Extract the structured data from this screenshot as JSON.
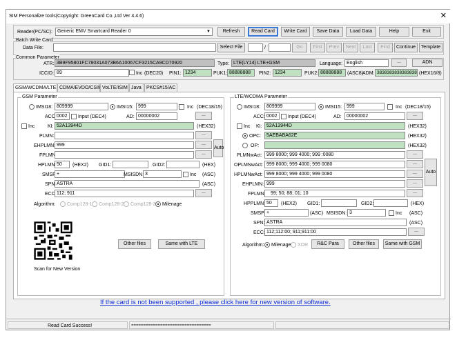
{
  "window": {
    "title": "SIM Personalize tools(Copyright: GreenCard Co.,Ltd Ver 4.4.6)",
    "close": "✕"
  },
  "toolbar": {
    "reader_label": "Reader(PC/SC):",
    "reader_value": "Generic EMV Smartcard Reader 0",
    "refresh": "Refresh",
    "read_card": "Read Card",
    "write_card": "Write Card",
    "save_data": "Save Data",
    "load_data": "Load Data",
    "help": "Help",
    "exit": "Exit"
  },
  "batch": {
    "title": "Batch Write Card",
    "data_file_label": "Data File:",
    "select_file": "Select File",
    "slash": "/",
    "go": "Go",
    "first": "First",
    "prev": "Prev",
    "next": "Next",
    "last": "Last",
    "find": "Find",
    "continue": "Continue",
    "template": "Template"
  },
  "common": {
    "title": "Common Parameter",
    "atr_label": "ATR:",
    "atr_value": "3B9F95801FC78031A073B6A10067CF3215CA9CD70920",
    "type_label": "Type:",
    "type_value": "LTE(LY14) LTE+GSM",
    "language_label": "Language:",
    "language_value": "English",
    "adn": "ADN",
    "iccid_label": "ICCID:",
    "iccid_value": "89",
    "inc": "Inc",
    "dec20": "(DEC20)",
    "pin1_label": "PIN1:",
    "pin1_value": "1234",
    "puk1_label": "PUK1:",
    "puk1_value": "88888888",
    "pin2_label": "PIN2:",
    "pin2_value": "1234",
    "puk2_label": "PUK2:",
    "puk2_value": "88888888",
    "asc8": "(ASC8)",
    "adm_label": "ADM:",
    "adm_value": "3838383838383838",
    "hex16_8": "(HEX16/8)"
  },
  "tabs": [
    "GSM/WCDMA/LTE",
    "CDMA/EVDO/CSIM",
    "VoLTE/ISIM",
    "Java",
    "PKCS#15/AC"
  ],
  "gsm": {
    "title": "GSM Parameter",
    "imsi18": "IMSI18:",
    "imsi18_value": "809999",
    "imsi15": "IMSI15:",
    "imsi15_value": "999",
    "inc": "Inc",
    "dec18_15": "(DEC18/15)",
    "acc_label": "ACC:",
    "acc_value": "0002",
    "input_dec4": "Input (DEC4)",
    "ad_label": "AD:",
    "ad_value": "00000002",
    "ki_inc": "Inc",
    "ki_label": "KI:",
    "ki_value": "52A13944D",
    "hex32": "(HEX32)",
    "plmn_label": "PLMN:",
    "plmn_value": "",
    "ehplmn_label": "EHPLMN:",
    "ehplmn_value": "999",
    "fplmn_label": "FPLMN:",
    "fplmn_value": "",
    "hplmn_label": "HPLMN:",
    "hplmn_value": "50",
    "hex2": "(HEX2)",
    "gid1_label": "GID1:",
    "gid2_label": "GID2:",
    "hex": "(HEX)",
    "smsp_label": "SMSP:",
    "smsp_value": "+",
    "msisdn_label": "MSISDN:",
    "msisdn_value": "3",
    "msisdn_inc": "Inc",
    "asc": "(ASC)",
    "spn_label": "SPN:",
    "spn_value": "ASTRA",
    "spn_asc": "(ASC)",
    "ecc_label": "ECC:",
    "ecc_value": "112; 911",
    "algorithm_label": "Algorithm:",
    "algo1": "Comp128-1",
    "algo2": "Comp128-2",
    "algo3": "Comp128-3",
    "algo4": "Milenage",
    "auto": "Auto",
    "dots": "...",
    "other_files": "Other files",
    "same_with_lte": "Same with LTE",
    "qr_caption": "Scan for New Version"
  },
  "lte": {
    "title": "LTE/WCDMA Parameter",
    "imsi18": "IMSI18:",
    "imsi18_value": "809999",
    "imsi15": "IMSI15:",
    "imsi15_value": "999",
    "inc": "Inc",
    "dec18_15": "(DEC18/15)",
    "acc_label": "ACC:",
    "acc_value": "0002",
    "input_dec4": "Input (DEC4)",
    "ad_label": "AD:",
    "ad_value": "00000002",
    "ki_inc": "Inc",
    "ki_label": "KI:",
    "ki_value": "52A13944D",
    "hex32": "(HEX32)",
    "opc_label": "OPC:",
    "opc_value": "5AEBABA62E",
    "opc_hex32": "(HEX32)",
    "op_label": "OP:",
    "op_value": "",
    "op_hex32": "(HEX32)",
    "plmnwact_label": "PLMNwAct:",
    "plmnwact_value": "999  8000; 999  4000; 999  :0080",
    "oplmnwact_label": "OPLMNwAct:",
    "oplmnwact_value": "999  8000; 999  4000; 999  0080",
    "hplmnwact_label": "HPLMNwAct:",
    "hplmnwact_value": "999  8000; 999  4000; 999  0080",
    "ehplmn_label": "EHPLMN:",
    "ehplmn_value": "999",
    "fplmn_label": "FPLMN:",
    "fplmn_value": "99;  50;  88;  01;  10",
    "hpplmn_label": "HPPLMN:",
    "hpplmn_value": "50",
    "hex2": "(HEX2)",
    "gid1_label": "GID1:",
    "gid2_label": "GID2:",
    "hex": "(HEX)",
    "smsp_label": "SMSP:",
    "smsp_value": "+",
    "smsp_asc": "(ASC)",
    "msisdn_label": "MSISDN:",
    "msisdn_value": "3",
    "msisdn_inc": "Inc",
    "spn_label": "SPN:",
    "spn_value": "ASTRA",
    "spn_asc": "(ASC)",
    "ecc_label": "ECC:",
    "ecc_value": "112;112:00; 911;911:00",
    "algorithm_label": "Algorithm:",
    "algo1": "Milenage",
    "algo2": "XOR",
    "rc_para": "R&C Para",
    "other_files": "Other files",
    "same_with_gsm": "Same with GSM",
    "auto": "Auto",
    "dots": "..."
  },
  "link": "If the card is not been supported , please click here for new version of software.",
  "status": {
    "message": "Read Card Success!",
    "progress": "================================="
  }
}
